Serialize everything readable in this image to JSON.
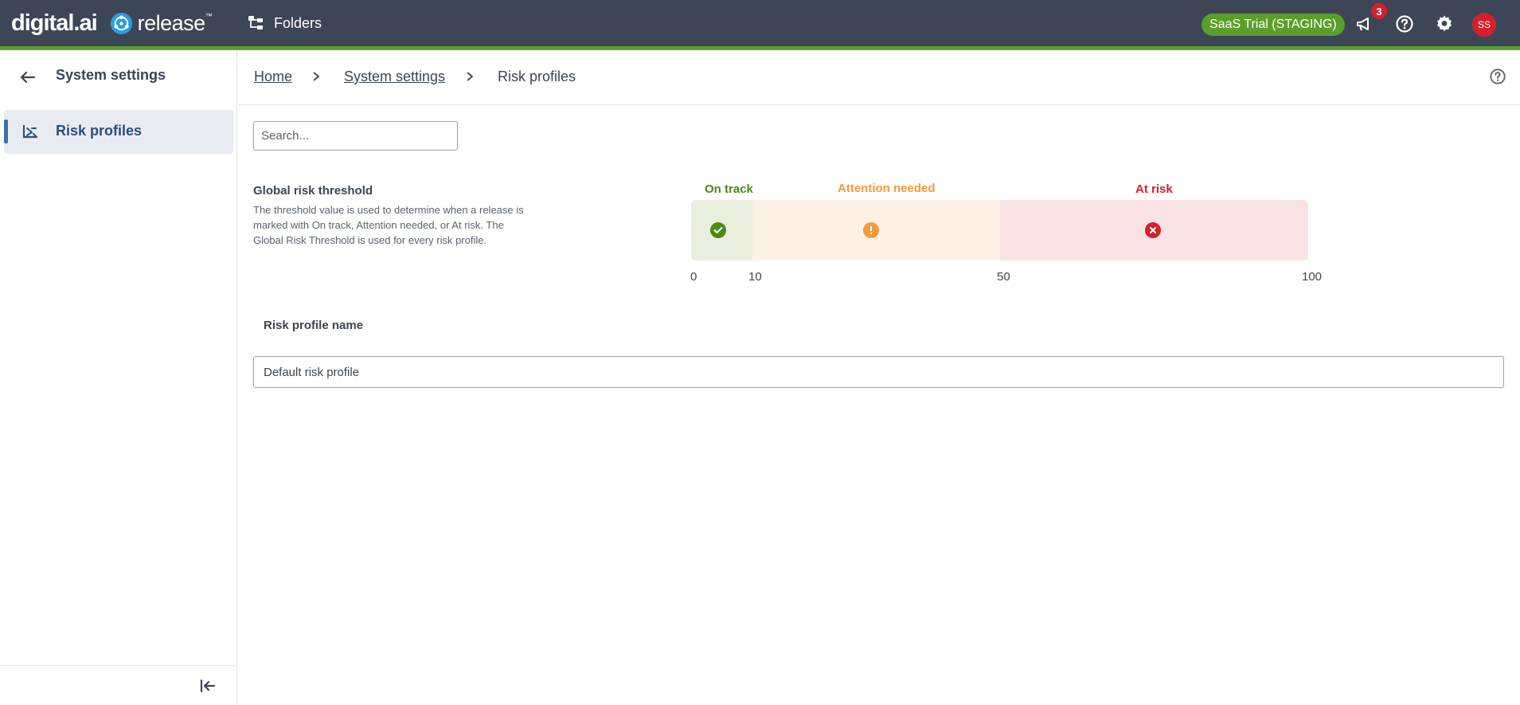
{
  "topbar": {
    "brand_digital": "digital.ai",
    "brand_release": "release",
    "brand_tm": "™",
    "folders_label": "Folders",
    "trial_badge": "SaaS Trial (STAGING)",
    "notifications_count": "3",
    "avatar_initials": "SS",
    "icons": [
      "folders-icon",
      "megaphone-icon",
      "help-icon",
      "gear-icon"
    ],
    "colors": {
      "bar": "#3c4656",
      "accent": "#5a9f2b",
      "badge": "#d61f2c"
    }
  },
  "sidebar": {
    "title": "System settings",
    "items": [
      {
        "label": "Risk profiles",
        "icon": "risk-profiles-icon",
        "active": true
      }
    ]
  },
  "breadcrumb": {
    "items": [
      {
        "label": "Home",
        "link": true
      },
      {
        "label": "System settings",
        "link": true
      },
      {
        "label": "Risk profiles",
        "link": false
      }
    ]
  },
  "search": {
    "placeholder": "Search...",
    "value": ""
  },
  "threshold": {
    "title": "Global risk threshold",
    "description": "The threshold value is used to determine when a release is marked with On track, Attention needed, or At risk. The Global Risk Threshold is used for every risk profile.",
    "segments": [
      {
        "label": "On track",
        "from": 0,
        "to": 10,
        "color": "#4c8a16",
        "bg": "#e8efdf",
        "icon": "check-circle-icon"
      },
      {
        "label": "Attention needed",
        "from": 10,
        "to": 50,
        "color": "#f59a3a",
        "bg": "#fff1e5",
        "icon": "exclamation-circle-icon"
      },
      {
        "label": "At risk",
        "from": 50,
        "to": 100,
        "color": "#d61f2c",
        "bg": "#fae3e4",
        "icon": "x-circle-icon"
      }
    ],
    "ticks": [
      "0",
      "10",
      "50",
      "100"
    ]
  },
  "table": {
    "column_header": "Risk profile name",
    "rows": [
      {
        "name": "Default risk profile"
      }
    ]
  }
}
